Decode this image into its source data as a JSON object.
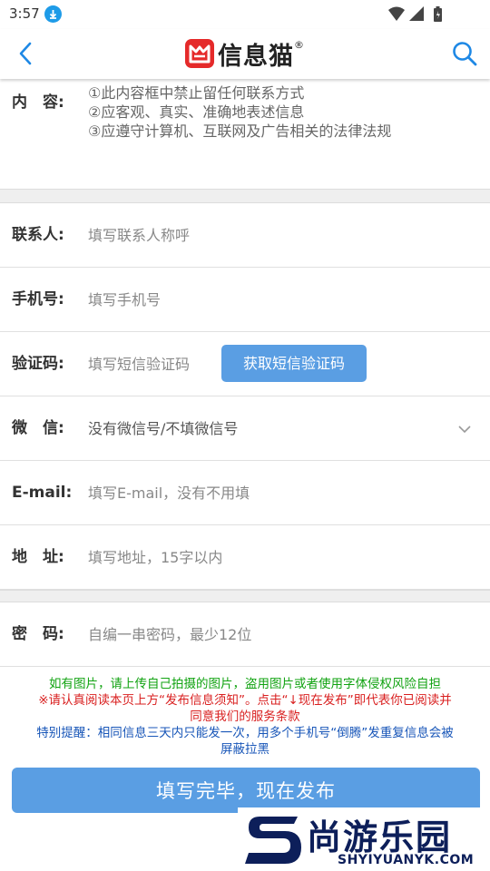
{
  "status_bar": {
    "time": "3:57",
    "download_icon": "download-icon",
    "icons": [
      "wifi-icon",
      "signal-icon",
      "battery-icon"
    ]
  },
  "navbar": {
    "app_name": "信息猫",
    "registered": "®",
    "back_icon": "chevron-left-icon",
    "search_icon": "search-icon"
  },
  "content_section": {
    "label": "内　容:",
    "rules": [
      "①此内容框中禁止留任何联系方式",
      "②应客观、真实、准确地表述信息",
      "③应遵守计算机、互联网及广告相关的法律法规"
    ]
  },
  "form": {
    "contact": {
      "label": "联系人:",
      "placeholder": "填写联系人称呼"
    },
    "phone": {
      "label": "手机号:",
      "placeholder": "填写手机号"
    },
    "verify": {
      "label": "验证码:",
      "placeholder": "填写短信验证码",
      "button": "获取短信验证码"
    },
    "wechat": {
      "label": "微　信:",
      "selected": "没有微信号/不填微信号"
    },
    "email": {
      "label": "E-mail:",
      "placeholder": "填写E-mail，没有不用填"
    },
    "address": {
      "label": "地　址:",
      "placeholder": "填写地址，15字以内"
    },
    "password": {
      "label": "密　码:",
      "placeholder": "自编一串密码，最少12位"
    }
  },
  "notice": {
    "line_green": "如有图片，请上传自己拍摄的图片，盗用图片或者使用字体侵权风险自担",
    "line_red_1": "※请认真阅读本页上方“发布信息须知”。点击“↓现在发布”即代表你已阅读并",
    "line_red_2": "同意我们的服务条款",
    "line_blue_1": "特别提醒：相同信息三天内只能发一次，用多个手机号“倒腾”发重复信息会被",
    "line_blue_2": "屏蔽拉黑"
  },
  "submit_label": "填写完毕，现在发布",
  "watermark": {
    "cn": "尚游乐园",
    "en": "SHYIYUANYK.COM"
  },
  "colors": {
    "primary_button": "#5a9ee3",
    "accent_blue": "#1e88e5",
    "notice_green": "#12a312",
    "notice_red": "#d91f1f",
    "notice_blue": "#1856b8",
    "logo_red": "#e52a2a"
  }
}
